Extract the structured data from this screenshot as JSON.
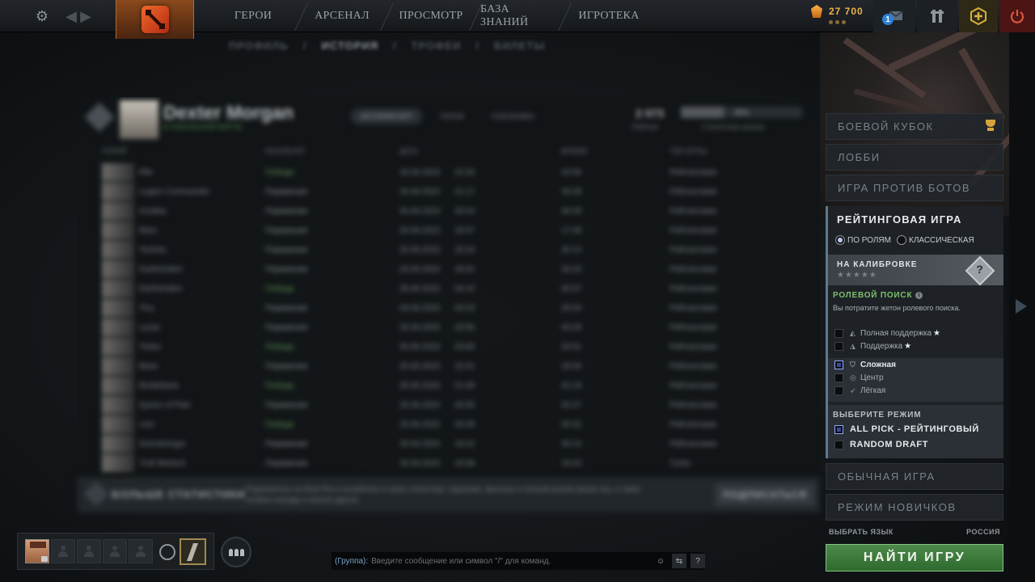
{
  "topbar": {
    "nav": [
      "ГЕРОИ",
      "АРСЕНАЛ",
      "ПРОСМОТР",
      "БАЗА ЗНАНИЙ",
      "ИГРОТЕКА"
    ],
    "currency": "27 700",
    "message_badge": "1"
  },
  "subnav": {
    "items": [
      "ПРОФИЛЬ",
      "ИСТОРИЯ",
      "ТРОФЕИ",
      "БИЛЕТЫ"
    ]
  },
  "profile": {
    "name": "Dexter Morgan",
    "subtitle": "В ЛОКАЛЬНОЙ МАТЧЕ",
    "tabs": [
      "ИСТОРИЯ ИГР",
      "ГЕРОИ",
      "СОЮЗНИКИ"
    ],
    "rank_value": "2 073",
    "rank_label": "Рейтинг",
    "bar_label": "35%",
    "bar_caption": "Статистика игрока",
    "bar_fill": 0.35
  },
  "match_table": {
    "headers": [
      "ГЕРОЙ",
      "РЕЗУЛЬТАТ",
      "ДАТА",
      "ВРЕМЯ",
      "ТИП ИГРЫ"
    ],
    "rows": [
      {
        "hero": "Riki",
        "result": "Победа",
        "win": true,
        "date": "26.06.2023",
        "time": "22:26",
        "duration": "42:06",
        "type": "Рейтинговая"
      },
      {
        "hero": "Legion Commander",
        "result": "Поражение",
        "win": false,
        "date": "26.06.2023",
        "time": "21:17",
        "duration": "33:28",
        "type": "Рейтинговая"
      },
      {
        "hero": "Kunkka",
        "result": "Поражение",
        "win": false,
        "date": "26.06.2023",
        "time": "20:24",
        "duration": "40:29",
        "type": "Рейтинговая"
      },
      {
        "hero": "Mars",
        "result": "Поражение",
        "win": false,
        "date": "26.06.2023",
        "time": "19:57",
        "duration": "17:48",
        "type": "Рейтинговая"
      },
      {
        "hero": "Techies",
        "result": "Поражение",
        "win": false,
        "date": "26.06.2023",
        "time": "19:16",
        "duration": "30:14",
        "type": "Рейтинговая"
      },
      {
        "hero": "Earthshaker",
        "result": "Поражение",
        "win": false,
        "date": "26.06.2023",
        "time": "18:31",
        "duration": "33:43",
        "type": "Рейтинговая"
      },
      {
        "hero": "Earthshaker",
        "result": "Победа",
        "win": true,
        "date": "26.06.2023",
        "time": "04:10",
        "duration": "40:57",
        "type": "Рейтинговая"
      },
      {
        "hero": "Tiny",
        "result": "Поражение",
        "win": false,
        "date": "26.06.2023",
        "time": "03:23",
        "duration": "20:04",
        "type": "Рейтинговая"
      },
      {
        "hero": "Lycan",
        "result": "Поражение",
        "win": false,
        "date": "25.06.2023",
        "time": "23:56",
        "duration": "43:29",
        "type": "Рейтинговая"
      },
      {
        "hero": "Tinker",
        "result": "Победа",
        "win": true,
        "date": "25.06.2023",
        "time": "23:06",
        "duration": "20:01",
        "type": "Рейтинговая"
      },
      {
        "hero": "Bane",
        "result": "Поражение",
        "win": false,
        "date": "25.06.2023",
        "time": "22:41",
        "duration": "18:34",
        "type": "Рейтинговая"
      },
      {
        "hero": "Bristleback",
        "result": "Победа",
        "win": true,
        "date": "25.06.2023",
        "time": "21:49",
        "duration": "42:19",
        "type": "Рейтинговая"
      },
      {
        "hero": "Queen of Pain",
        "result": "Поражение",
        "win": false,
        "date": "25.06.2023",
        "time": "20:55",
        "duration": "32:27",
        "type": "Рейтинговая"
      },
      {
        "hero": "Lion",
        "result": "Победа",
        "win": true,
        "date": "25.06.2023",
        "time": "20:28",
        "duration": "20:32",
        "type": "Рейтинговая"
      },
      {
        "hero": "Doombringer",
        "result": "Поражение",
        "win": false,
        "date": "25.06.2023",
        "time": "19:22",
        "duration": "30:14",
        "type": "Рейтинговая"
      },
      {
        "hero": "Troll Warlord",
        "result": "Поражение",
        "win": false,
        "date": "25.06.2023",
        "time": "16:08",
        "duration": "19:23",
        "type": "Turbo"
      }
    ]
  },
  "stats_banner": {
    "title": "БОЛЬШЕ СТАТИСТИКИ",
    "text": "Подпишитесь на Dota Plus и углубитесь в свою статистику: подсказки, фильтры и полный анализ ваших игр, а также особые награды и многое другое.",
    "button": "ПОДПИСАТЬСЯ"
  },
  "play_panel": {
    "modes_top": [
      "БОЕВОЙ КУБОК",
      "ЛОББИ",
      "ИГРА ПРОТИВ БОТОВ"
    ],
    "ranked_title": "РЕЙТИНГОВАЯ ИГРА",
    "radio_roles": "ПО РОЛЯМ",
    "radio_classic": "КЛАССИЧЕСКАЯ",
    "calibration_title": "НА КАЛИБРОВКЕ",
    "calibration_stars": "★★★★★",
    "calibration_medal": "?",
    "role_search_title": "РОЛЕВОЙ ПОИСК",
    "role_search_sub": "Вы потратите жетон ролевого поиска.",
    "roles_support": [
      {
        "label": "Полная поддержка",
        "star": "★",
        "icon": "◭"
      },
      {
        "label": "Поддержка",
        "star": "★",
        "icon": "◮"
      }
    ],
    "roles_core": [
      {
        "label": "Сложная",
        "icon": "⛉",
        "checked": true
      },
      {
        "label": "Центр",
        "icon": "◎",
        "checked": false
      },
      {
        "label": "Лёгкая",
        "icon": "➶",
        "checked": false
      }
    ],
    "mode_select_title": "ВЫБЕРИТЕ РЕЖИМ",
    "mode_options": [
      {
        "label": "ALL PICK - РЕЙТИНГОВЫЙ",
        "checked": true
      },
      {
        "label": "RANDOM DRAFT",
        "checked": false
      }
    ],
    "modes_bottom": [
      "ОБЫЧНАЯ ИГРА",
      "РЕЖИМ НОВИЧКОВ"
    ],
    "language_label": "ВЫБРАТЬ ЯЗЫК",
    "region": "РОССИЯ",
    "find_button": "НАЙТИ ИГРУ"
  },
  "chat": {
    "channel": "(Группа):",
    "placeholder": "Введите сообщение или символ \"/\" для команд.",
    "help": "?"
  },
  "colors": {
    "find_green": "#3f7c3d",
    "role_green": "#7cc16d",
    "gold": "#e9b54c",
    "accent_blue": "#5a7a91"
  }
}
